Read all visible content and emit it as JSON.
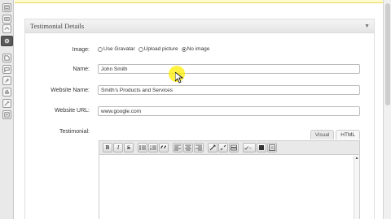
{
  "admin_menu": {
    "icons": [
      "posts-icon",
      "media-icon",
      "links-icon",
      "testimonials-icon",
      "pages-icon",
      "comments-icon",
      "appearance-icon",
      "plugins-icon",
      "tools-icon",
      "settings-icon"
    ]
  },
  "postbox": {
    "title": "Testimonial Details",
    "toggle_glyph": "▼"
  },
  "image_field": {
    "label": "Image:",
    "options": [
      {
        "label": "Use Gravatar",
        "checked": false
      },
      {
        "label": "Upload picture",
        "checked": false
      },
      {
        "label": "No image",
        "checked": true
      }
    ]
  },
  "name_field": {
    "label": "Name:",
    "value": "John Smith"
  },
  "website_name_field": {
    "label": "Website Name:",
    "value": "Smith's Products and Services"
  },
  "website_url_field": {
    "label": "Website URL:",
    "value": "www.google.com"
  },
  "testimonial_field": {
    "label": "Testimonial:",
    "tabs": [
      "Visual",
      "HTML"
    ],
    "active_tab": "Visual",
    "toolbar": [
      {
        "name": "bold-button",
        "glyph": "B"
      },
      {
        "name": "italic-button",
        "glyph": "I"
      },
      {
        "name": "strikethrough-button",
        "glyph": "S"
      },
      {
        "name": "bullet-list-button",
        "glyph": "list"
      },
      {
        "name": "numbered-list-button",
        "glyph": "olist"
      },
      {
        "name": "blockquote-button",
        "glyph": "quote"
      },
      {
        "name": "align-left-button",
        "glyph": "align"
      },
      {
        "name": "align-center-button",
        "glyph": "align"
      },
      {
        "name": "align-right-button",
        "glyph": "align"
      },
      {
        "name": "insert-link-button",
        "glyph": "link"
      },
      {
        "name": "unlink-button",
        "glyph": "unlink"
      },
      {
        "name": "insert-more-button",
        "glyph": "more"
      },
      {
        "name": "spellcheck-button",
        "glyph": "spell"
      },
      {
        "name": "fullscreen-button",
        "glyph": "full"
      },
      {
        "name": "kitchen-sink-button",
        "glyph": "sink"
      }
    ]
  },
  "colors": {
    "header_bg": "#e4e4e4",
    "notice_border": "#e6db55",
    "cursor_highlight": "#ffee00"
  }
}
